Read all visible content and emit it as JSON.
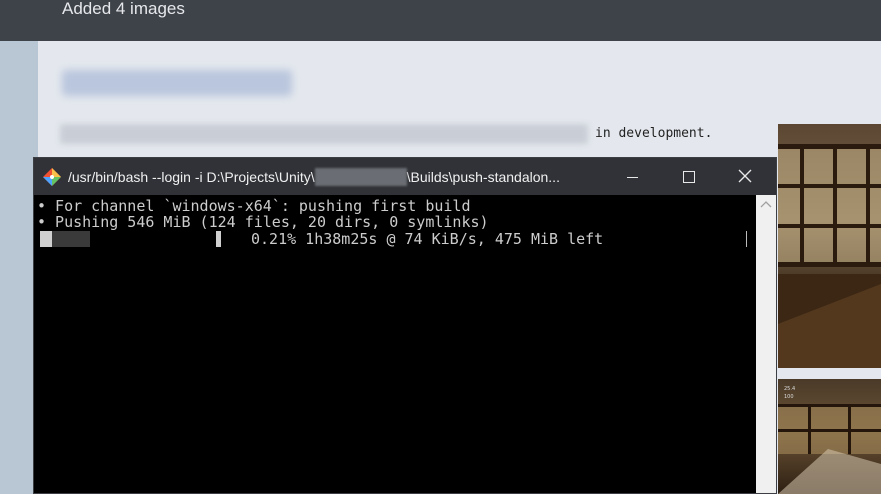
{
  "background_page": {
    "header_title": "Added 4 images",
    "body_tail_text": "in development."
  },
  "thumbnail_hud": {
    "line1": "25.4",
    "line2": "100"
  },
  "terminal": {
    "title_prefix": "/usr/bin/bash --login -i D:\\Projects\\Unity\\",
    "title_suffix": "\\Builds\\push-standalon...",
    "lines": [
      "• For channel `windows-x64`: pushing first build",
      "• Pushing 546 MiB (124 files, 20 dirs, 0 symlinks)"
    ],
    "progress": {
      "percent_value": 0.21,
      "status_text": "0.21% 1h38m25s @ 74 KiB/s, 475 MiB left"
    }
  },
  "colors": {
    "terminal_bg": "#000000",
    "terminal_text": "#cccccc",
    "titlebar_bg": "#303237",
    "page_header_bg": "#3e434a"
  },
  "icons": {
    "app": "git-bash-diamond-icon",
    "minimize": "minimize-icon",
    "maximize": "maximize-icon",
    "close": "close-icon",
    "scroll_up": "scroll-up-arrow-icon"
  }
}
